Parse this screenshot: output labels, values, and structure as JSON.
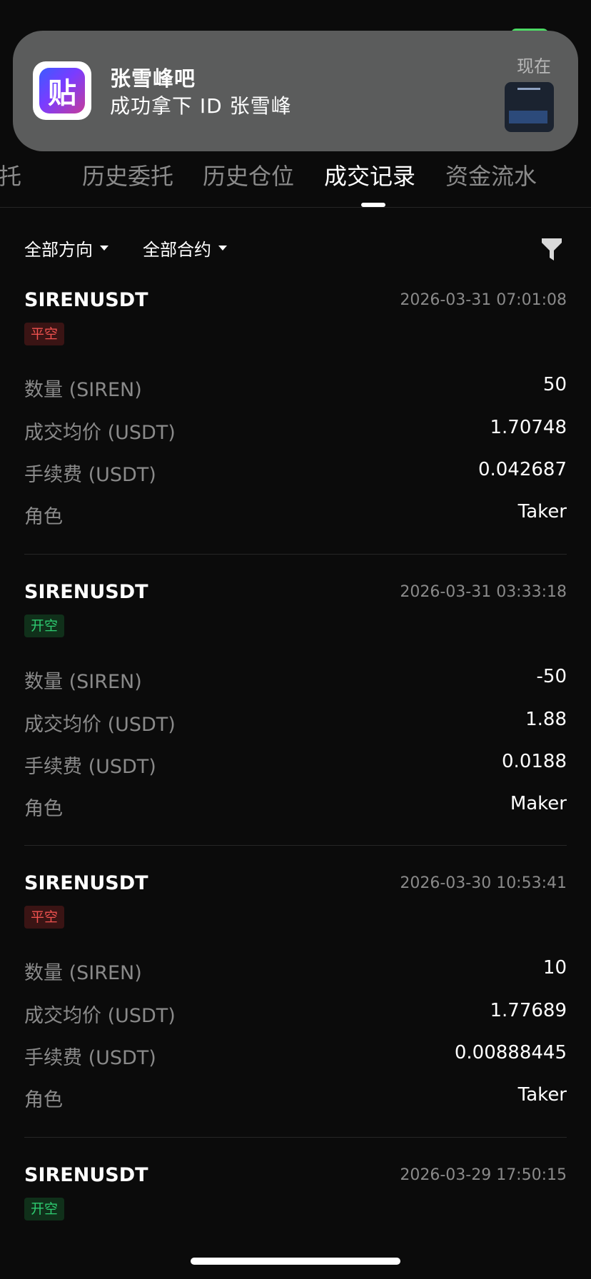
{
  "notification": {
    "app_icon": "tieba-app-icon",
    "app_glyph": "贴",
    "title": "张雪峰吧",
    "body": "成功拿下 ID 张雪峰",
    "time": "现在",
    "thumbnail_icon": "image-thumbnail"
  },
  "tabs": [
    {
      "label": "托"
    },
    {
      "label": "历史委托"
    },
    {
      "label": "历史仓位"
    },
    {
      "label": "成交记录"
    },
    {
      "label": "资金流水"
    }
  ],
  "active_tab": "成交记录",
  "filters": {
    "direction": "全部方向",
    "contract": "全部合约",
    "filter_icon": "funnel-icon"
  },
  "row_labels": {
    "quantity": "数量 (SIREN)",
    "avg_price": "成交均价 (USDT)",
    "fee": "手续费 (USDT)",
    "role": "角色"
  },
  "records": [
    {
      "symbol": "SIRENUSDT",
      "time": "2026-03-31 07:01:08",
      "side": "平空",
      "side_type": "close",
      "quantity": "50",
      "avg_price": "1.70748",
      "fee": "0.042687",
      "role": "Taker"
    },
    {
      "symbol": "SIRENUSDT",
      "time": "2026-03-31 03:33:18",
      "side": "开空",
      "side_type": "open",
      "quantity": "-50",
      "avg_price": "1.88",
      "fee": "0.0188",
      "role": "Maker"
    },
    {
      "symbol": "SIRENUSDT",
      "time": "2026-03-30 10:53:41",
      "side": "平空",
      "side_type": "close",
      "quantity": "10",
      "avg_price": "1.77689",
      "fee": "0.00888445",
      "role": "Taker"
    },
    {
      "symbol": "SIRENUSDT",
      "time": "2026-03-29 17:50:15",
      "side": "开空",
      "side_type": "open"
    }
  ],
  "colors": {
    "background": "#0b0b0b",
    "close_side": "#f0524f",
    "open_side": "#2ecc71",
    "muted_text": "#8a8a8a"
  }
}
